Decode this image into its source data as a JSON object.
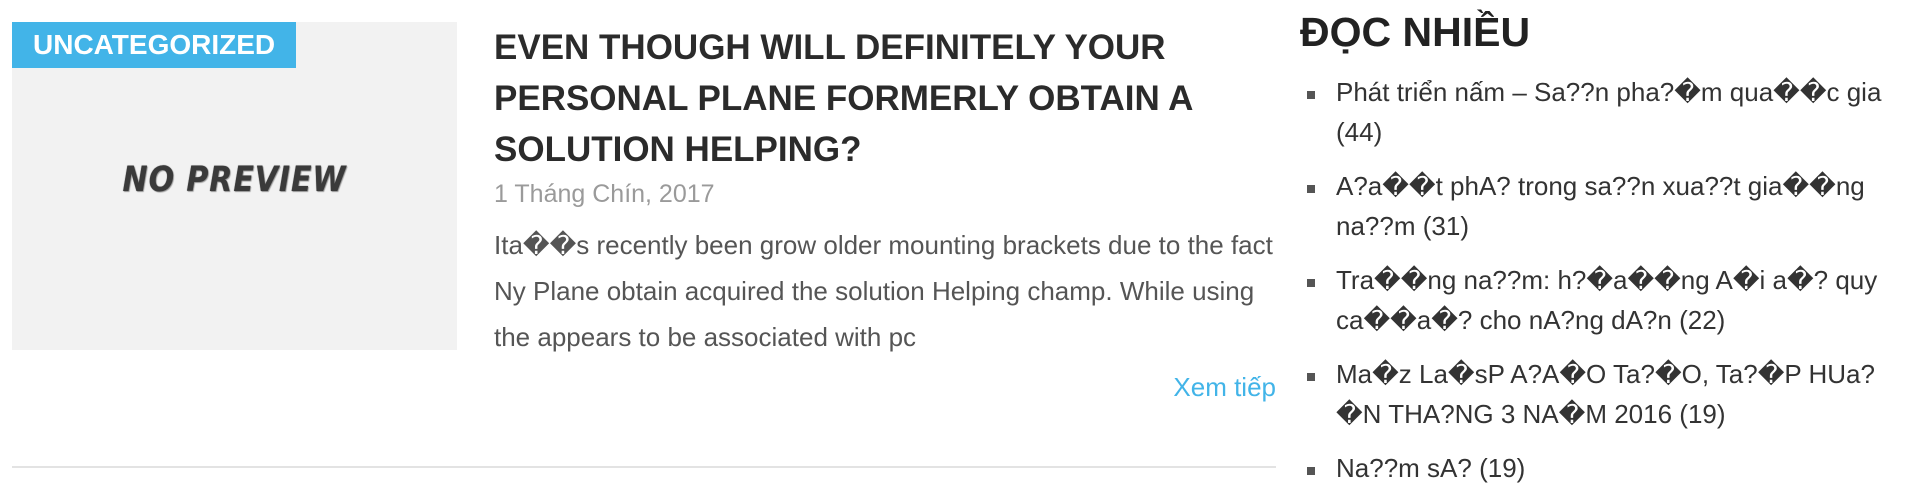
{
  "post": {
    "category": "UNCATEGORIZED",
    "thumbnail_text": "NO PREVIEW",
    "title": "EVEN THOUGH WILL DEFINITELY YOUR PERSONAL PLANE FORMERLY OBTAIN A SOLUTION HELPING?",
    "date": "1 Tháng Chín, 2017",
    "excerpt": "Ita��s recently been grow older mounting brackets due to the fact Ny Plane obtain acquired the solution Helping champ. While using the appears to be associated with pc",
    "read_more": "Xem tiếp"
  },
  "sidebar": {
    "title": "ĐỌC NHIỀU",
    "items": [
      {
        "label": "Phát triển nấm – Sa??n pha?�m qua��c gia",
        "count": "(44)"
      },
      {
        "label": "A?a��t phA? trong sa??n xua??t gia��ng na??m",
        "count": "(31)"
      },
      {
        "label": "Tra��ng na??m: h?�a��ng A�i a�? quy ca��a�? cho nA?ng dA?n",
        "count": "(22)"
      },
      {
        "label": "Ma�z La�sP A?A�O Ta?�O, Ta?�P HUa?�N THA?NG 3 NA�M 2016",
        "count": "(19)"
      },
      {
        "label": "Na??m sA? ",
        "count": "(19)"
      }
    ]
  }
}
